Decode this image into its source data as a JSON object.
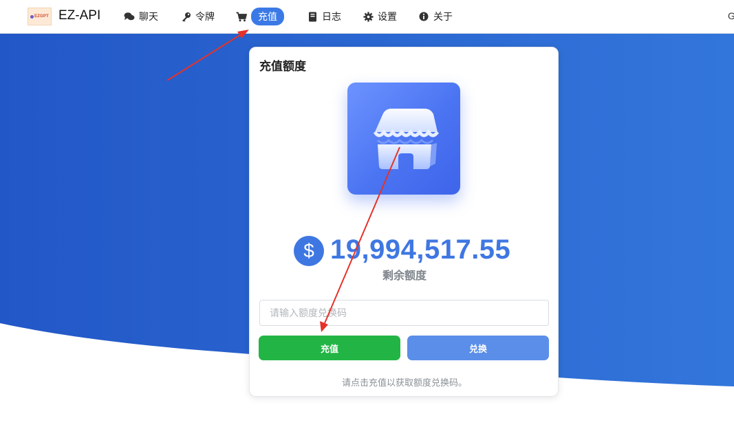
{
  "nav": {
    "logo_text": "EZGPT",
    "brand": "EZ-API",
    "items": [
      {
        "label": "聊天",
        "icon": "chat-icon"
      },
      {
        "label": "令牌",
        "icon": "key-icon"
      },
      {
        "label": "充值",
        "icon": "cart-icon",
        "active": true
      },
      {
        "label": "日志",
        "icon": "book-icon"
      },
      {
        "label": "设置",
        "icon": "gear-icon"
      },
      {
        "label": "关于",
        "icon": "info-icon"
      }
    ],
    "overflow_text": "G"
  },
  "card": {
    "title": "充值额度",
    "store_icon": "store-icon",
    "currency_symbol": "$",
    "balance": "19,994,517.55",
    "balance_label": "剩余额度",
    "input_placeholder": "请输入额度兑换码",
    "input_value": "",
    "topup_button": "充值",
    "redeem_button": "兑换",
    "hint": "请点击充值以获取额度兑换码。"
  },
  "colors": {
    "primary_blue": "#3f77e2",
    "background_blue": "#2f6cd6",
    "green": "#22b545",
    "redeem_blue": "#5a8ee8",
    "arrow_red": "#e53229"
  }
}
